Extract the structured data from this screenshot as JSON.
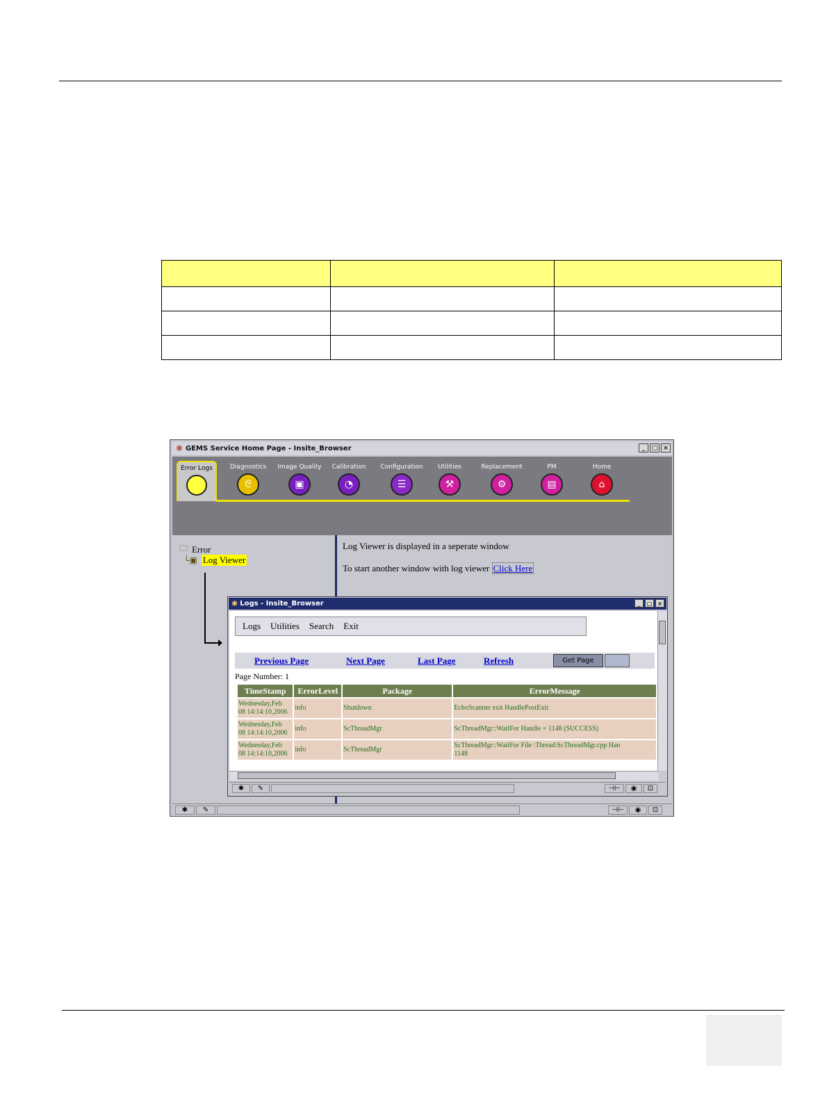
{
  "main_window": {
    "title": "GEMS Service Home Page - Insite_Browser",
    "toolbar": [
      {
        "label": "Error Logs",
        "icon": "error-logs-icon",
        "color": "#ffff40",
        "active": true
      },
      {
        "label": "Diagnostics",
        "icon": "stethoscope-icon",
        "color": "#e8c000"
      },
      {
        "label": "Image Quality",
        "icon": "image-quality-icon",
        "color": "#7a20c0"
      },
      {
        "label": "Calibration",
        "icon": "calibration-icon",
        "color": "#7a20c0"
      },
      {
        "label": "Configuration",
        "icon": "configuration-icon",
        "color": "#8a28c8"
      },
      {
        "label": "Utilities",
        "icon": "utilities-icon",
        "color": "#d020a0"
      },
      {
        "label": "Replacement",
        "icon": "replacement-icon",
        "color": "#d020a0"
      },
      {
        "label": "PM",
        "icon": "pm-icon",
        "color": "#d020a0"
      },
      {
        "label": "Home",
        "icon": "home-icon",
        "color": "#e01030"
      }
    ],
    "tree": {
      "folder": "Error",
      "item": "Log Viewer"
    },
    "message_line1": "Log Viewer is displayed in a seperate window",
    "message_line2": "To start another window with log viewer",
    "click_here": "Click Here"
  },
  "logs_window": {
    "title": "Logs - Insite_Browser",
    "menu": [
      "Logs",
      "Utilities",
      "Search",
      "Exit"
    ],
    "nav": {
      "previous": "Previous Page",
      "next": "Next Page",
      "last": "Last Page",
      "refresh": "Refresh",
      "get_page": "Get Page"
    },
    "page_number": "Page Number: 1",
    "columns": [
      "TimeStamp",
      "ErrorLevel",
      "Package",
      "ErrorMessage"
    ],
    "rows": [
      {
        "timestamp1": "Wednesday,Feb",
        "timestamp2": "08 14:14:10,2006",
        "level": "info",
        "package": "Shutdown",
        "message1": "EchoScanner exit HandlePostExit",
        "message2": ""
      },
      {
        "timestamp1": "Wednesday,Feb",
        "timestamp2": "08 14:14:10,2006",
        "level": "info",
        "package": "ScThreadMgr",
        "message1": "ScThreadMgr::WaitFor Handle = 1148 (SUCCESS)",
        "message2": ""
      },
      {
        "timestamp1": "Wednesday,Feb",
        "timestamp2": "08 14:14:10,2006",
        "level": "info",
        "package": "ScThreadMgr",
        "message1": "ScThreadMgr::WaitFor File :Thread\\ScThreadMgr.cpp Han",
        "message2": "1148"
      }
    ]
  }
}
